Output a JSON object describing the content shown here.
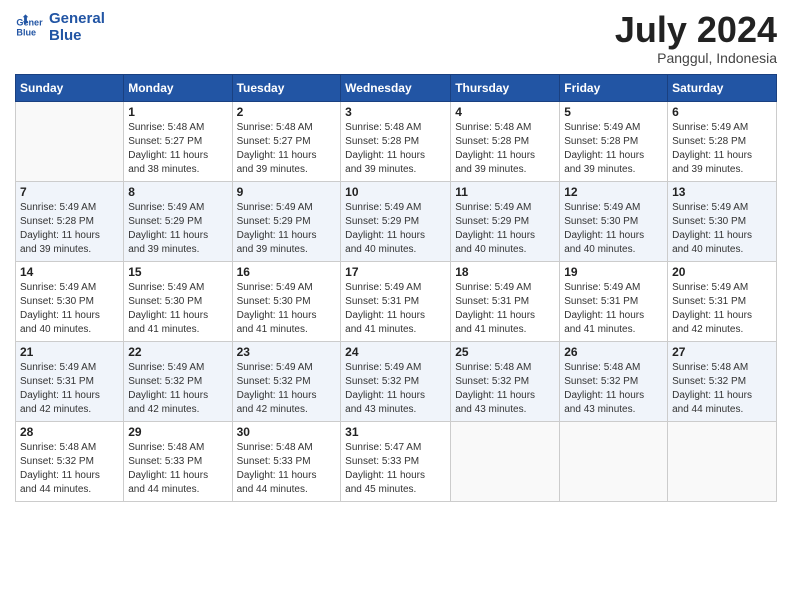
{
  "logo": {
    "line1": "General",
    "line2": "Blue"
  },
  "title": "July 2024",
  "location": "Panggul, Indonesia",
  "headers": [
    "Sunday",
    "Monday",
    "Tuesday",
    "Wednesday",
    "Thursday",
    "Friday",
    "Saturday"
  ],
  "weeks": [
    [
      {
        "day": "",
        "info": ""
      },
      {
        "day": "1",
        "info": "Sunrise: 5:48 AM\nSunset: 5:27 PM\nDaylight: 11 hours\nand 38 minutes."
      },
      {
        "day": "2",
        "info": "Sunrise: 5:48 AM\nSunset: 5:27 PM\nDaylight: 11 hours\nand 39 minutes."
      },
      {
        "day": "3",
        "info": "Sunrise: 5:48 AM\nSunset: 5:28 PM\nDaylight: 11 hours\nand 39 minutes."
      },
      {
        "day": "4",
        "info": "Sunrise: 5:48 AM\nSunset: 5:28 PM\nDaylight: 11 hours\nand 39 minutes."
      },
      {
        "day": "5",
        "info": "Sunrise: 5:49 AM\nSunset: 5:28 PM\nDaylight: 11 hours\nand 39 minutes."
      },
      {
        "day": "6",
        "info": "Sunrise: 5:49 AM\nSunset: 5:28 PM\nDaylight: 11 hours\nand 39 minutes."
      }
    ],
    [
      {
        "day": "7",
        "info": "Sunrise: 5:49 AM\nSunset: 5:28 PM\nDaylight: 11 hours\nand 39 minutes."
      },
      {
        "day": "8",
        "info": "Sunrise: 5:49 AM\nSunset: 5:29 PM\nDaylight: 11 hours\nand 39 minutes."
      },
      {
        "day": "9",
        "info": "Sunrise: 5:49 AM\nSunset: 5:29 PM\nDaylight: 11 hours\nand 39 minutes."
      },
      {
        "day": "10",
        "info": "Sunrise: 5:49 AM\nSunset: 5:29 PM\nDaylight: 11 hours\nand 40 minutes."
      },
      {
        "day": "11",
        "info": "Sunrise: 5:49 AM\nSunset: 5:29 PM\nDaylight: 11 hours\nand 40 minutes."
      },
      {
        "day": "12",
        "info": "Sunrise: 5:49 AM\nSunset: 5:30 PM\nDaylight: 11 hours\nand 40 minutes."
      },
      {
        "day": "13",
        "info": "Sunrise: 5:49 AM\nSunset: 5:30 PM\nDaylight: 11 hours\nand 40 minutes."
      }
    ],
    [
      {
        "day": "14",
        "info": "Sunrise: 5:49 AM\nSunset: 5:30 PM\nDaylight: 11 hours\nand 40 minutes."
      },
      {
        "day": "15",
        "info": "Sunrise: 5:49 AM\nSunset: 5:30 PM\nDaylight: 11 hours\nand 41 minutes."
      },
      {
        "day": "16",
        "info": "Sunrise: 5:49 AM\nSunset: 5:30 PM\nDaylight: 11 hours\nand 41 minutes."
      },
      {
        "day": "17",
        "info": "Sunrise: 5:49 AM\nSunset: 5:31 PM\nDaylight: 11 hours\nand 41 minutes."
      },
      {
        "day": "18",
        "info": "Sunrise: 5:49 AM\nSunset: 5:31 PM\nDaylight: 11 hours\nand 41 minutes."
      },
      {
        "day": "19",
        "info": "Sunrise: 5:49 AM\nSunset: 5:31 PM\nDaylight: 11 hours\nand 41 minutes."
      },
      {
        "day": "20",
        "info": "Sunrise: 5:49 AM\nSunset: 5:31 PM\nDaylight: 11 hours\nand 42 minutes."
      }
    ],
    [
      {
        "day": "21",
        "info": "Sunrise: 5:49 AM\nSunset: 5:31 PM\nDaylight: 11 hours\nand 42 minutes."
      },
      {
        "day": "22",
        "info": "Sunrise: 5:49 AM\nSunset: 5:32 PM\nDaylight: 11 hours\nand 42 minutes."
      },
      {
        "day": "23",
        "info": "Sunrise: 5:49 AM\nSunset: 5:32 PM\nDaylight: 11 hours\nand 42 minutes."
      },
      {
        "day": "24",
        "info": "Sunrise: 5:49 AM\nSunset: 5:32 PM\nDaylight: 11 hours\nand 43 minutes."
      },
      {
        "day": "25",
        "info": "Sunrise: 5:48 AM\nSunset: 5:32 PM\nDaylight: 11 hours\nand 43 minutes."
      },
      {
        "day": "26",
        "info": "Sunrise: 5:48 AM\nSunset: 5:32 PM\nDaylight: 11 hours\nand 43 minutes."
      },
      {
        "day": "27",
        "info": "Sunrise: 5:48 AM\nSunset: 5:32 PM\nDaylight: 11 hours\nand 44 minutes."
      }
    ],
    [
      {
        "day": "28",
        "info": "Sunrise: 5:48 AM\nSunset: 5:32 PM\nDaylight: 11 hours\nand 44 minutes."
      },
      {
        "day": "29",
        "info": "Sunrise: 5:48 AM\nSunset: 5:33 PM\nDaylight: 11 hours\nand 44 minutes."
      },
      {
        "day": "30",
        "info": "Sunrise: 5:48 AM\nSunset: 5:33 PM\nDaylight: 11 hours\nand 44 minutes."
      },
      {
        "day": "31",
        "info": "Sunrise: 5:47 AM\nSunset: 5:33 PM\nDaylight: 11 hours\nand 45 minutes."
      },
      {
        "day": "",
        "info": ""
      },
      {
        "day": "",
        "info": ""
      },
      {
        "day": "",
        "info": ""
      }
    ]
  ]
}
